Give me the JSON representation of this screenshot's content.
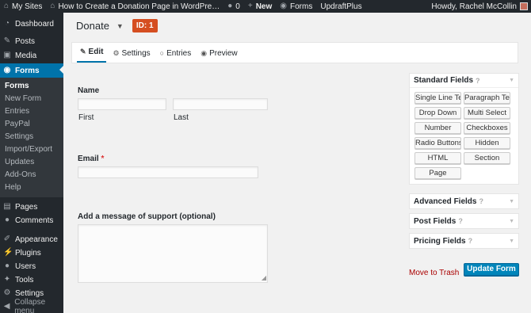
{
  "adminbar": {
    "my_sites": "My Sites",
    "site_name": "How to Create a Donation Page in WordPre…",
    "comments_count": "0",
    "new_label": "New",
    "forms_label": "Forms",
    "plugin_label": "UpdraftPlus",
    "howdy": "Howdy, Rachel McCollin"
  },
  "sidebar": {
    "dashboard": "Dashboard",
    "posts": "Posts",
    "media": "Media",
    "forms": "Forms",
    "submenu": [
      "Forms",
      "New Form",
      "Entries",
      "PayPal",
      "Settings",
      "Import/Export",
      "Updates",
      "Add-Ons",
      "Help"
    ],
    "pages": "Pages",
    "comments": "Comments",
    "appearance": "Appearance",
    "plugins": "Plugins",
    "users": "Users",
    "tools": "Tools",
    "settings": "Settings",
    "collapse": "Collapse menu"
  },
  "header": {
    "form_title": "Donate",
    "id_badge": "ID: 1"
  },
  "tabs": [
    "Edit",
    "Settings",
    "Entries",
    "Preview"
  ],
  "fields": {
    "name_label": "Name",
    "first_label": "First",
    "last_label": "Last",
    "email_label": "Email",
    "required_mark": "*",
    "message_label": "Add a message of support (optional)"
  },
  "panels": {
    "standard_title": "Standard Fields",
    "standard_buttons": [
      "Single Line Text",
      "Paragraph Text",
      "Drop Down",
      "Multi Select",
      "Number",
      "Checkboxes",
      "Radio Buttons",
      "Hidden",
      "HTML",
      "Section",
      "Page"
    ],
    "advanced_title": "Advanced Fields",
    "post_title": "Post Fields",
    "pricing_title": "Pricing Fields"
  },
  "actions": {
    "trash": "Move to Trash",
    "update": "Update Form"
  },
  "colors": {
    "accent": "#0073aa",
    "badge": "#d54e21",
    "update_button": "#0085ba",
    "trash": "#a00000"
  }
}
